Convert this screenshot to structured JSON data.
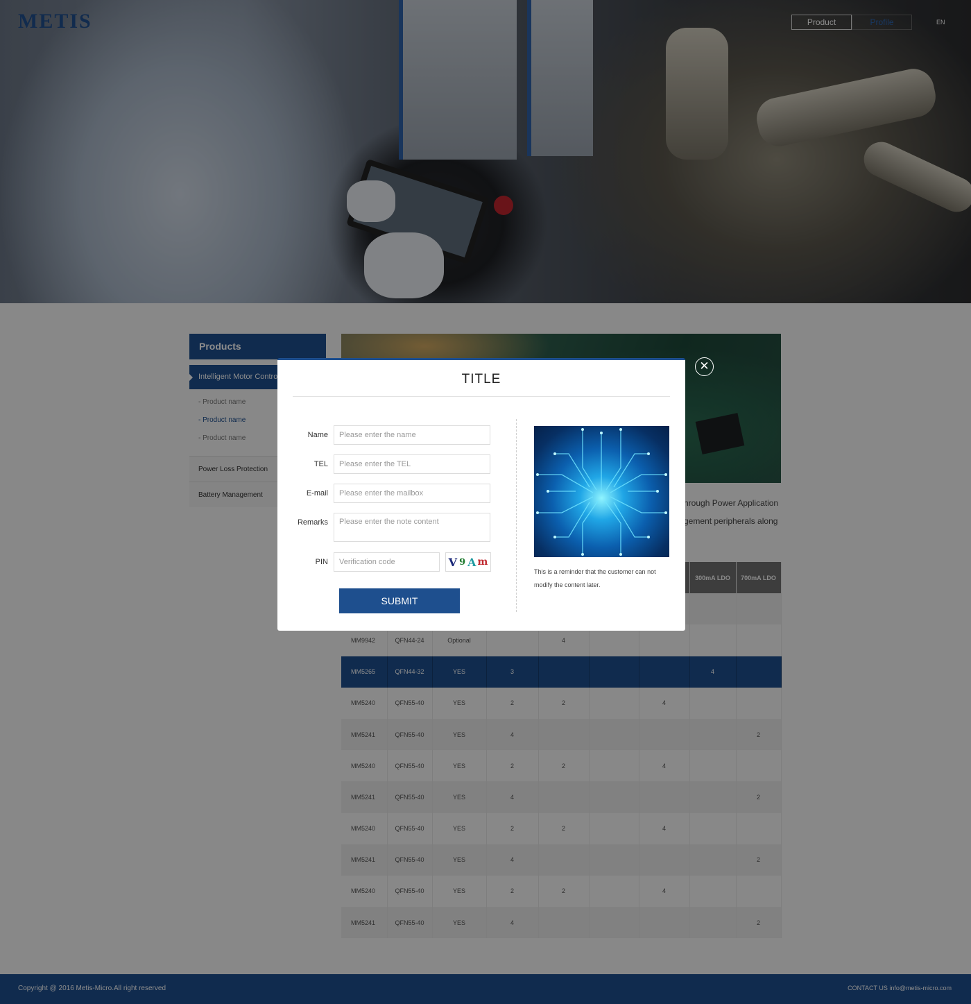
{
  "header": {
    "logo": "METIS",
    "nav": [
      {
        "label": "Product"
      },
      {
        "label": "Profile"
      }
    ],
    "lang": "EN"
  },
  "sidebar": {
    "title": "Products",
    "active": "Intelligent Motor Control",
    "sub_items": [
      "- Product name",
      "- Product name",
      "- Product name"
    ],
    "items": [
      "Power Loss Protection",
      "Battery Management"
    ]
  },
  "content": {
    "desc_line1": "hrough Power Application",
    "desc_line2": "gement peripherals along",
    "table": {
      "headers": [
        "",
        "",
        "",
        "",
        "",
        "",
        "",
        "300mA LDO",
        "700mA LDO"
      ],
      "rows": [
        [
          "",
          "",
          "",
          "",
          "",
          "",
          "",
          "",
          ""
        ],
        [
          "MM9942",
          "QFN44-24",
          "Optional",
          "",
          "4",
          "",
          "",
          "",
          ""
        ],
        [
          "MM5265",
          "QFN44-32",
          "YES",
          "3",
          "",
          "",
          "",
          "4",
          ""
        ],
        [
          "MM5240",
          "QFN55-40",
          "YES",
          "2",
          "2",
          "",
          "4",
          "",
          ""
        ],
        [
          "MM5241",
          "QFN55-40",
          "YES",
          "4",
          "",
          "",
          "",
          "",
          "2"
        ],
        [
          "MM5240",
          "QFN55-40",
          "YES",
          "2",
          "2",
          "",
          "4",
          "",
          ""
        ],
        [
          "MM5241",
          "QFN55-40",
          "YES",
          "4",
          "",
          "",
          "",
          "",
          "2"
        ],
        [
          "MM5240",
          "QFN55-40",
          "YES",
          "2",
          "2",
          "",
          "4",
          "",
          ""
        ],
        [
          "MM5241",
          "QFN55-40",
          "YES",
          "4",
          "",
          "",
          "",
          "",
          "2"
        ],
        [
          "MM5240",
          "QFN55-40",
          "YES",
          "2",
          "2",
          "",
          "4",
          "",
          ""
        ],
        [
          "MM5241",
          "QFN55-40",
          "YES",
          "4",
          "",
          "",
          "",
          "",
          "2"
        ]
      ]
    }
  },
  "modal": {
    "title": "TITLE",
    "close_icon": "close-circle-icon",
    "fields": {
      "name": {
        "label": "Name",
        "placeholder": "Please enter the name"
      },
      "tel": {
        "label": "TEL",
        "placeholder": "Please enter the TEL"
      },
      "email": {
        "label": "E-mail",
        "placeholder": "Please enter the mailbox"
      },
      "remarks": {
        "label": "Remarks",
        "placeholder": "Please enter the note content"
      },
      "pin": {
        "label": "PIN",
        "placeholder": "Verification code"
      }
    },
    "captcha": [
      "V",
      "9",
      "A",
      "m"
    ],
    "submit": "SUBMIT",
    "reminder": "This is a reminder that the customer can not modify the content later."
  },
  "footer": {
    "copyright": "Copyright @ 2016 Metis-Micro.All right reserved",
    "contact": "CONTACT US info@metis-micro.com"
  },
  "colors": {
    "brand": "#1e4f8e",
    "overlay": "rgba(0,0,0,0.45)"
  }
}
